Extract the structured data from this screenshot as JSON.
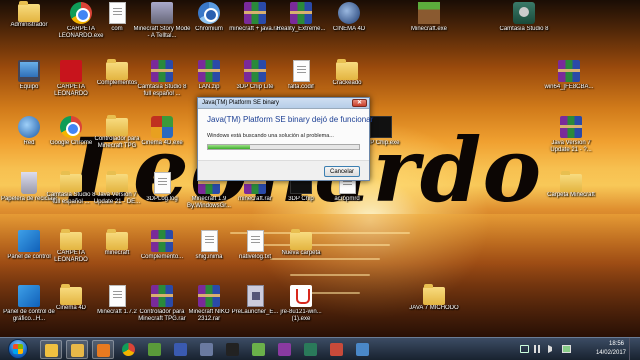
{
  "wallpaper": {
    "text": "Leonardo"
  },
  "icons": [
    {
      "label": "Administrador",
      "type": "folder"
    },
    {
      "label": "CARPETA LEONARDO.exe",
      "type": "chrome"
    },
    {
      "label": "com",
      "type": "doc"
    },
    {
      "label": "Minecraft Story Mode - A Telltal...",
      "type": "archive"
    },
    {
      "label": "Chromium",
      "type": "chromium"
    },
    {
      "label": "minecraft + java.rar",
      "type": "rar"
    },
    {
      "label": "Reality_Extreme...",
      "type": "rar"
    },
    {
      "label": "CINEMA 4D",
      "type": "c4d"
    },
    {
      "label": "Minecraft.exe",
      "type": "grass"
    },
    {
      "label": "Camtasia Studio 8",
      "type": "cam"
    },
    {
      "label": "Equipo",
      "type": "pc"
    },
    {
      "label": "CARPETA LEONARDO",
      "type": "pdf"
    },
    {
      "label": "Complementos",
      "type": "folder"
    },
    {
      "label": "Camtasia Studio 8 full español ...",
      "type": "rar"
    },
    {
      "label": "LAN.zip",
      "type": "rar"
    },
    {
      "label": "3DP Chip Lite",
      "type": "rar"
    },
    {
      "label": "falta.codif",
      "type": "doc"
    },
    {
      "label": "Crackeado",
      "type": "folder"
    },
    {
      "label": "win64_[FE8CBA...",
      "type": "rar"
    },
    {
      "label": "Red",
      "type": "network"
    },
    {
      "label": "Google Chrome",
      "type": "chrome"
    },
    {
      "label": "Controlador para Minecraft TPG",
      "type": "folder"
    },
    {
      "label": "Cinema 4D.exe",
      "type": "camtasia"
    },
    {
      "label": "3DP Chip.exe",
      "type": "dark"
    },
    {
      "label": "Java Version 7 Update 21 - ?...",
      "type": "rar"
    },
    {
      "label": "Papelera de reciclaje",
      "type": "bin"
    },
    {
      "label": "Camtasia Studio 8 full español ...",
      "type": "folder"
    },
    {
      "label": "Java Version 7 Update 21 - DE...",
      "type": "folder"
    },
    {
      "label": "3DPLog.log",
      "type": "doc"
    },
    {
      "label": "Minecraft 1.9 By.WindowsGr...",
      "type": "rar"
    },
    {
      "label": "minecraft.rar",
      "type": "rar"
    },
    {
      "label": "3DP Chip",
      "type": "dark"
    },
    {
      "label": "acropmrd",
      "type": "doc"
    },
    {
      "label": "Carpeta Minecraft",
      "type": "folder"
    },
    {
      "label": "Panel de control",
      "type": "panel"
    },
    {
      "label": "CARPETA LEONARDO",
      "type": "folder"
    },
    {
      "label": "minecraft",
      "type": "folder"
    },
    {
      "label": "Complemento...",
      "type": "rar"
    },
    {
      "label": "shig.inima",
      "type": "doc"
    },
    {
      "label": "nativelog.txt",
      "type": "doc"
    },
    {
      "label": "Nueva carpeta",
      "type": "folder"
    },
    {
      "label": "Panel de control de gráfico...H...",
      "type": "panel"
    },
    {
      "label": "Cinema 4D",
      "type": "folder"
    },
    {
      "label": "Minecraft 1.7.2",
      "type": "doc"
    },
    {
      "label": "Controlador para Minecraft TPG.rar",
      "type": "rar"
    },
    {
      "label": "Minecraft NIKO 2312.rar",
      "type": "rar"
    },
    {
      "label": "PreLauncher_E...",
      "type": "chipdoc"
    },
    {
      "label": "jre-8u121-win... (1).exe",
      "type": "java"
    },
    {
      "label": "JAVA 7 MICHODO",
      "type": "folder"
    }
  ],
  "dialog": {
    "title": "Java(TM) Platform SE binary",
    "close_glyph": "✕",
    "heading": "Java(TM) Platform SE binary dejó de funcionar",
    "message": "Windows está buscando una solución al problema...",
    "progress": 0.28,
    "cancel_label": "Cancelar"
  },
  "taskbar": {
    "items": [
      "explorer",
      "folder",
      "media-player",
      "chrome",
      "minecraft",
      "c4d",
      "cinema",
      "terminal",
      "minecraft2",
      "archive",
      "cam",
      "paint",
      "app"
    ],
    "time": "18:56",
    "date": "14/02/2017"
  }
}
